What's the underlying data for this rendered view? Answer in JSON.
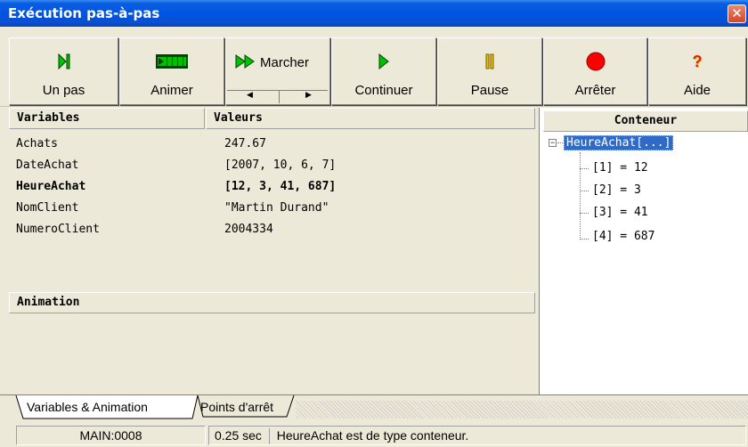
{
  "window": {
    "title": "Exécution pas-à-pas"
  },
  "toolbar": {
    "step": "Un pas",
    "animate": "Animer",
    "walk": "Marcher",
    "continue": "Continuer",
    "pause": "Pause",
    "stop": "Arrêter",
    "help": "Aide"
  },
  "variables": {
    "col_name": "Variables",
    "col_value": "Valeurs",
    "rows": [
      {
        "name": "Achats",
        "value": "247.67"
      },
      {
        "name": "DateAchat",
        "value": "[2007, 10, 6, 7]"
      },
      {
        "name": "HeureAchat",
        "value": "[12, 3, 41, 687]"
      },
      {
        "name": "NomClient",
        "value": "\"Martin Durand\""
      },
      {
        "name": "NumeroClient",
        "value": "2004334"
      }
    ]
  },
  "animation": {
    "header": "Animation"
  },
  "container": {
    "header": "Conteneur",
    "root": "HeureAchat[...]",
    "items": [
      "[1] = 12",
      "[2] = 3",
      "[3] = 41",
      "[4] = 687"
    ],
    "expander": "−"
  },
  "tabs": {
    "variables_animation": "Variables & Animation",
    "breakpoints": "Points d'arrêt"
  },
  "status": {
    "location": "MAIN:0008",
    "time": "0.25 sec",
    "message": "HeureAchat est de type conteneur."
  },
  "colors": {
    "titlebar": "#0054e3",
    "selection": "#316ac5",
    "panel": "#ece9d8",
    "green": "#00c000",
    "red": "#ff0000"
  }
}
